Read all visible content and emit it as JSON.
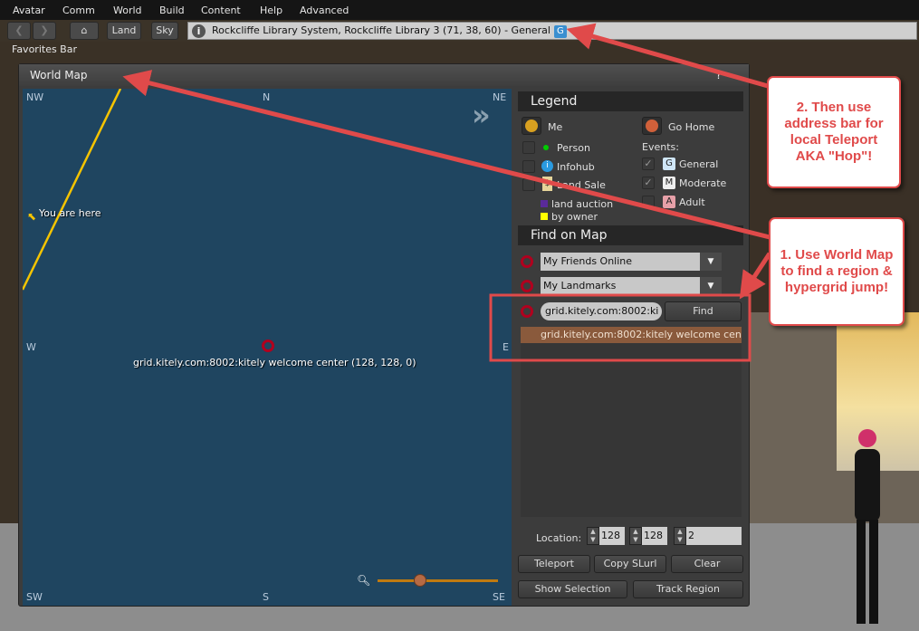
{
  "menubar": {
    "items": [
      "Avatar",
      "Comm",
      "World",
      "Build",
      "Content",
      "Help",
      "Advanced"
    ]
  },
  "navbar": {
    "back_icon": "chevron-left-icon",
    "forward_icon": "chevron-right-icon",
    "home_icon": "home-icon",
    "land_label": "Land",
    "sky_label": "Sky",
    "address": "Rockcliffe Library System, Rockcliffe Library 3 (71, 38, 60) - General",
    "maturity_badge": "G",
    "favorites_label": "Favorites Bar"
  },
  "world_map": {
    "title": "World Map",
    "help": "?",
    "minimize": "–",
    "directions": {
      "nw": "NW",
      "n": "N",
      "ne": "NE",
      "w": "W",
      "e": "E",
      "sw": "SW",
      "s": "S",
      "se": "SE"
    },
    "you_are_here": "You are here",
    "destination_label": "grid.kitely.com:8002:kitely welcome center (128, 128, 0)",
    "zoom_level": 0.35,
    "legend": {
      "title": "Legend",
      "me": "Me",
      "go_home": "Go Home",
      "person": "Person",
      "infohub": "Infohub",
      "land_sale": "Land Sale",
      "land_auction": "land auction",
      "by_owner": "by owner",
      "events_label": "Events:",
      "general": "General",
      "moderate": "Moderate",
      "adult": "Adult",
      "general_badge": "G",
      "moderate_badge": "M",
      "adult_badge": "A",
      "general_checked": true,
      "moderate_checked": true,
      "adult_checked": false
    },
    "find": {
      "title": "Find on Map",
      "friends_select": "My Friends Online",
      "landmarks_select": "My Landmarks",
      "search_value": "grid.kitely.com:8002:ki",
      "find_button": "Find",
      "results": [
        "grid.kitely.com:8002:kitely welcome cen.."
      ]
    },
    "location": {
      "label": "Location:",
      "x": "128",
      "y": "128",
      "z": "2"
    },
    "buttons": {
      "teleport": "Teleport",
      "copy_slurl": "Copy SLurl",
      "clear": "Clear",
      "show_selection": "Show Selection",
      "track_region": "Track Region"
    }
  },
  "callouts": {
    "step2": "2.  Then use address bar for local Teleport AKA \"Hop\"!",
    "step1": "1.  Use World Map to find a region & hypergrid jump!"
  },
  "colors": {
    "annotation_red": "#e04a4a",
    "map_water": "#1f4560",
    "selected_result": "#8a5a3c",
    "you_are_here": "#f5c400",
    "destination_ring": "#b0001e"
  }
}
